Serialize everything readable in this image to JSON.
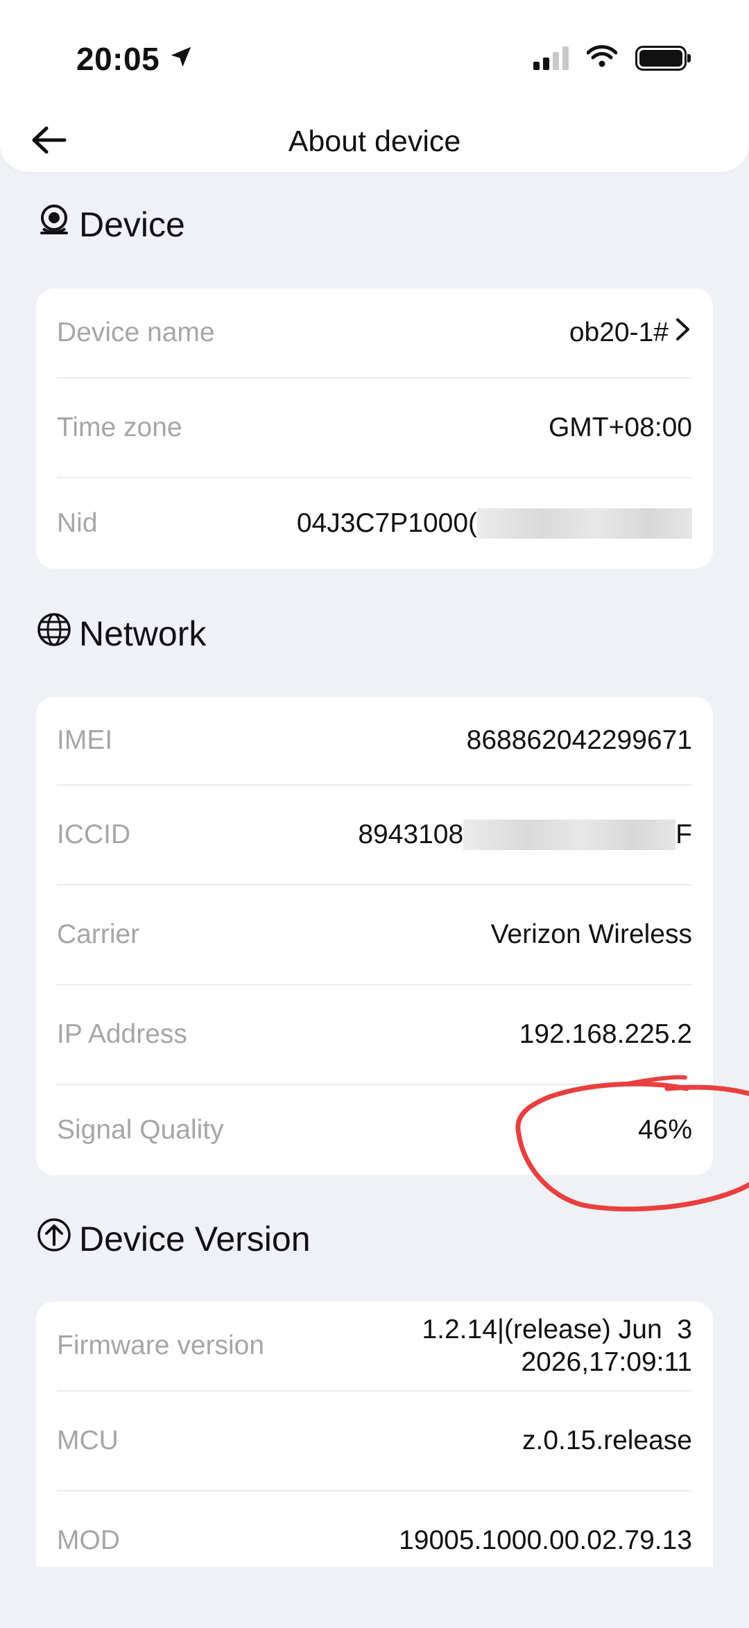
{
  "status_bar": {
    "time": "20:05",
    "icons": [
      "location-arrow-icon",
      "cellular-signal-icon",
      "wifi-icon",
      "battery-icon"
    ]
  },
  "nav": {
    "title": "About device",
    "back_icon": "arrow-left-icon"
  },
  "sections": {
    "device": {
      "title": "Device",
      "icon": "camera-icon",
      "rows": [
        {
          "label": "Device name",
          "value": "ob20-1#"
        },
        {
          "label": "Time zone",
          "value": "GMT+08:00"
        },
        {
          "label": "Nid",
          "value": "04J3C7P1000("
        }
      ]
    },
    "network": {
      "title": "Network",
      "icon": "globe-icon",
      "rows": [
        {
          "label": "IMEI",
          "value": "868862042299671"
        },
        {
          "label": "ICCID",
          "value": "8943108",
          "value_suffix": "F"
        },
        {
          "label": "Carrier",
          "value": "Verizon Wireless"
        },
        {
          "label": "IP Address",
          "value": "192.168.225.2"
        },
        {
          "label": "Signal Quality",
          "value": "46%"
        }
      ]
    },
    "version": {
      "title": "Device Version",
      "icon": "arrow-up-circle-icon",
      "rows": [
        {
          "label": "Firmware version",
          "value_line1": "1.2.14|(release) Jun  3",
          "value_line2": "2026,17:09:11"
        },
        {
          "label": "MCU",
          "value": "z.0.15.release"
        },
        {
          "label": "MOD",
          "value": "19005.1000.00.02.79.13"
        }
      ]
    }
  },
  "colors": {
    "background": "#f0f1f5",
    "card": "#ffffff",
    "label": "#a6a6aa",
    "value": "#111111",
    "annotation": "#e8403f"
  }
}
